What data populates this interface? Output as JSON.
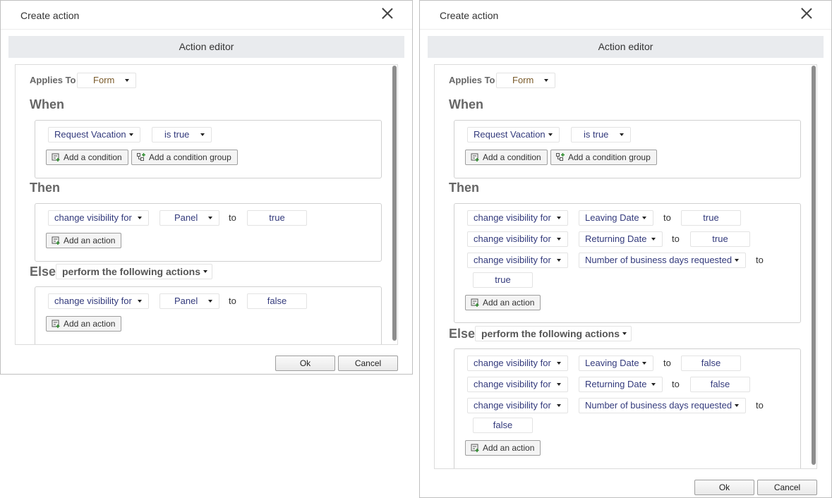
{
  "dialogs": [
    {
      "title": "Create action",
      "tab": "Action editor",
      "applies_to_label": "Applies To",
      "applies_to_value": "Form",
      "when_heading": "When",
      "when": {
        "field": "Request Vacation",
        "operator": "is true",
        "add_condition": "Add a condition",
        "add_condition_group": "Add a condition group"
      },
      "then_heading": "Then",
      "then_rows": [
        {
          "action": "change visibility for",
          "target": "Panel",
          "to": "to",
          "value": "true"
        }
      ],
      "add_action": "Add an action",
      "else_heading": "Else",
      "else_mode": "perform the following actions",
      "else_rows": [
        {
          "action": "change visibility for",
          "target": "Panel",
          "to": "to",
          "value": "false"
        }
      ],
      "ok": "Ok",
      "cancel": "Cancel"
    },
    {
      "title": "Create action",
      "tab": "Action editor",
      "applies_to_label": "Applies To",
      "applies_to_value": "Form",
      "when_heading": "When",
      "when": {
        "field": "Request Vacation",
        "operator": "is true",
        "add_condition": "Add a condition",
        "add_condition_group": "Add a condition group"
      },
      "then_heading": "Then",
      "then_rows": [
        {
          "action": "change visibility for",
          "target": "Leaving Date",
          "to": "to",
          "value": "true"
        },
        {
          "action": "change visibility for",
          "target": "Returning Date",
          "to": "to",
          "value": "true"
        },
        {
          "action": "change visibility for",
          "target": "Number of business days requested",
          "to": "to",
          "value": "true"
        }
      ],
      "add_action": "Add an action",
      "else_heading": "Else",
      "else_mode": "perform the following actions",
      "else_rows": [
        {
          "action": "change visibility for",
          "target": "Leaving Date",
          "to": "to",
          "value": "false"
        },
        {
          "action": "change visibility for",
          "target": "Returning Date",
          "to": "to",
          "value": "false"
        },
        {
          "action": "change visibility for",
          "target": "Number of business days requested",
          "to": "to",
          "value": "false"
        }
      ],
      "ok": "Ok",
      "cancel": "Cancel"
    }
  ],
  "icons": {
    "close": "close-icon",
    "add_condition": "add-condition-icon",
    "add_group": "add-condition-group-icon",
    "add_action": "add-action-icon"
  }
}
